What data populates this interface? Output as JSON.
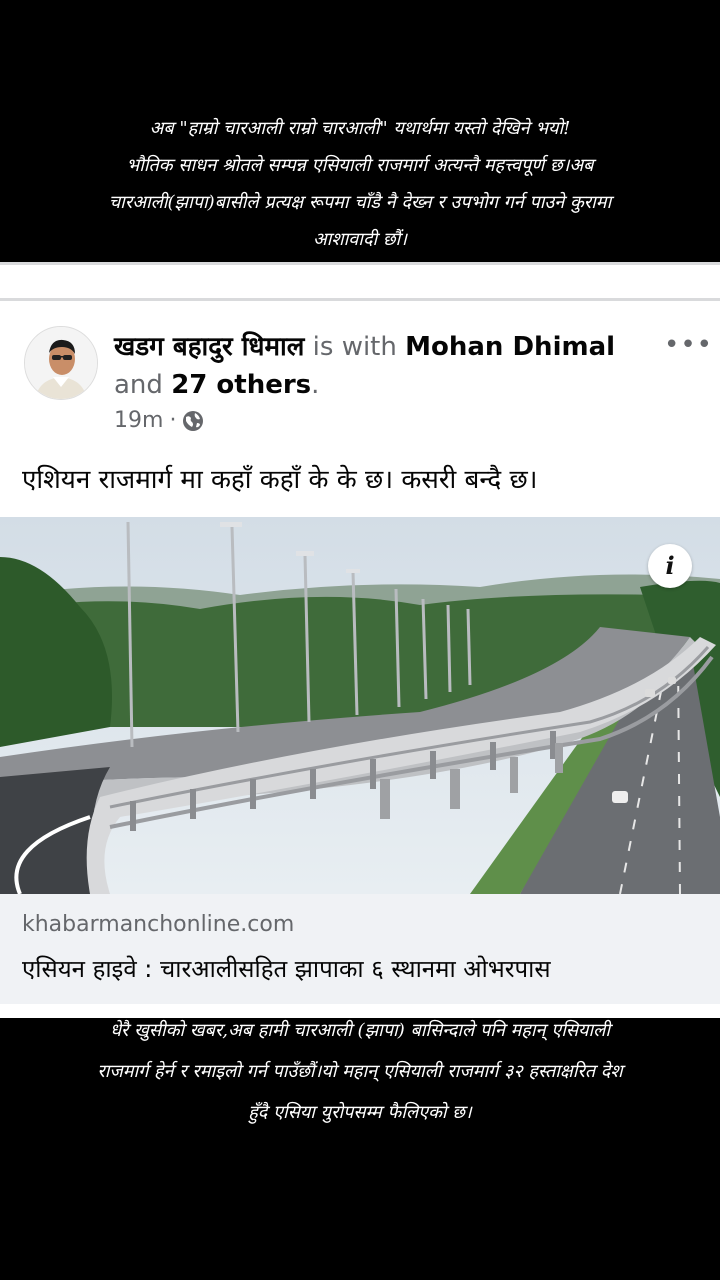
{
  "top_caption": {
    "line1": "अब \"हाम्रो चारआली राम्रो चारआली\" यथार्थमा यस्तो देखिने भयो!",
    "line2": "भौतिक साधन श्रोतले सम्पन्न एसियाली राजमार्ग अत्यन्तै महत्त्वपूर्ण छ।अब",
    "line3": "चारआली(झापा)बासीले प्रत्यक्ष रूपमा चाँडै नै देख्न र उपभोग गर्न पाउने कुरामा",
    "line4": "आशावादी छौं।"
  },
  "post": {
    "author": "खडग बहादुर धिमाल",
    "with_text": "is with",
    "tagged": "Mohan Dhimal",
    "and_text": "and",
    "others": "27 others",
    "period": ".",
    "time": "19m",
    "dot": "·",
    "text": "एशियन राजमार्ग मा कहाँ कहाँ के के छ। कसरी बन्दै छ।",
    "more_label": "•••",
    "link": {
      "domain": "khabarmanchonline.com",
      "title": "एसियन हाइवे : चारआलीसहित झापाका ६ स्थानमा ओभरपास",
      "info_label": "i"
    }
  },
  "bottom_caption": {
    "line1": "धेरै खुसीको खबर,अब हामी चारआली (झापा) बासिन्दाले पनि महान् एसियाली",
    "line2": "राजमार्ग हेर्न र रमाइलो गर्न पाउँछौं।यो महान् एसियाली राजमार्ग ३२ हस्ताक्षरित देश",
    "line3": "हुँदै एसिया युरोपसम्म फैलिएको छ।"
  },
  "icons": {
    "globe": "globe-icon",
    "more": "more-options-icon",
    "info": "info-icon"
  },
  "colors": {
    "background": "#000000",
    "card": "#ffffff",
    "secondary_text": "#65676b",
    "link_footer": "#f0f2f5"
  }
}
